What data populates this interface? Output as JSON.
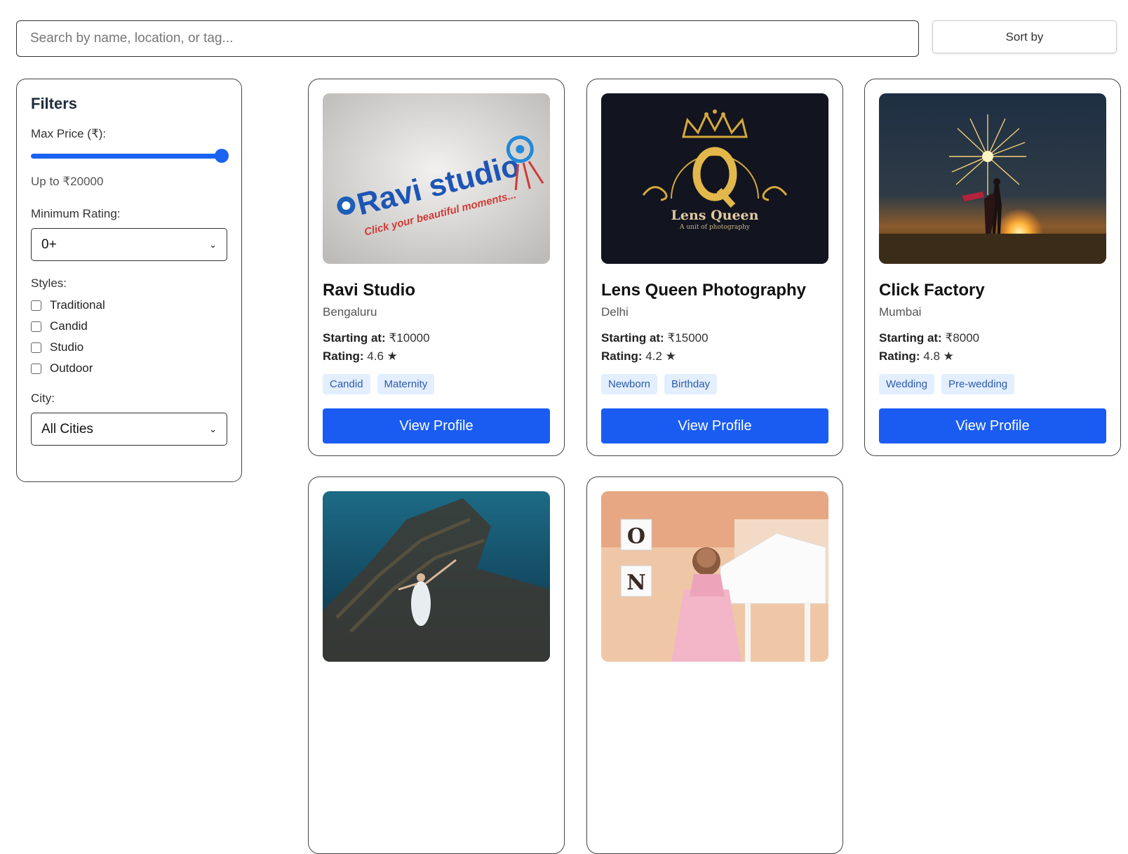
{
  "search": {
    "placeholder": "Search by name, location, or tag..."
  },
  "sort": {
    "label": "Sort by"
  },
  "filters": {
    "title": "Filters",
    "max_price_label": "Max Price (₹):",
    "max_price_fraction": 1.0,
    "max_price_note": "Up to ₹20000",
    "min_rating_label": "Minimum Rating:",
    "min_rating_value": "0+",
    "styles_label": "Styles:",
    "styles": [
      "Traditional",
      "Candid",
      "Studio",
      "Outdoor"
    ],
    "city_label": "City:",
    "city_value": "All Cities"
  },
  "cards": [
    {
      "name": "Ravi Studio",
      "city": "Bengaluru",
      "price_label": "Starting at:",
      "price": "₹10000",
      "rating_label": "Rating:",
      "rating": "4.6 ★",
      "tags": [
        "Candid",
        "Maternity"
      ],
      "button": "View Profile",
      "logo_text": "Ravi studio",
      "logo_tagline": "Click your beautiful moments..."
    },
    {
      "name": "Lens Queen Photography",
      "city": "Delhi",
      "price_label": "Starting at:",
      "price": "₹15000",
      "rating_label": "Rating:",
      "rating": "4.2 ★",
      "tags": [
        "Newborn",
        "Birthday"
      ],
      "button": "View Profile",
      "logo_text": "Lens Queen",
      "logo_tagline": "A unit of photography"
    },
    {
      "name": "Click Factory",
      "city": "Mumbai",
      "price_label": "Starting at:",
      "price": "₹8000",
      "rating_label": "Rating:",
      "rating": "4.8 ★",
      "tags": [
        "Wedding",
        "Pre-wedding"
      ],
      "button": "View Profile"
    },
    {},
    {
      "photo_letters": [
        "O",
        "N"
      ]
    }
  ]
}
